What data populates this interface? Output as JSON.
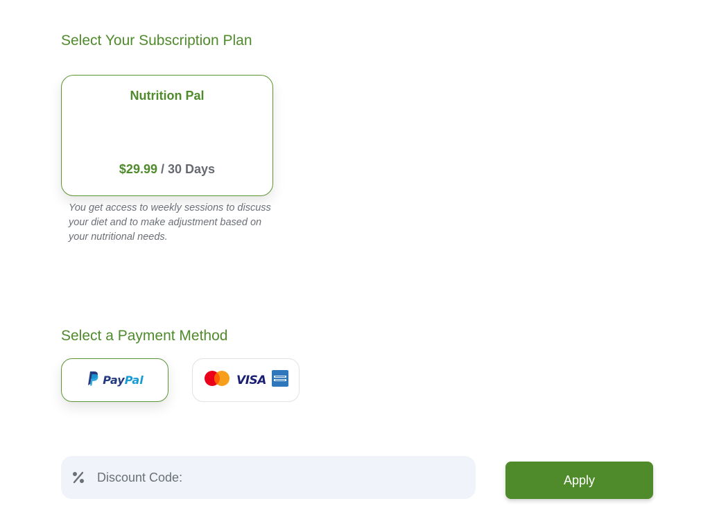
{
  "subscription": {
    "title": "Select Your Subscription Plan",
    "plan": {
      "name": "Nutrition Pal",
      "price": "$29.99",
      "separator": " / ",
      "period": "30 Days",
      "description": "You get access to weekly sessions to discuss your diet and to make adjustment based on your nutritional needs."
    }
  },
  "payment": {
    "title": "Select a Payment Method",
    "methods": [
      {
        "label_pay": "Pay",
        "label_pal": "Pal",
        "icon": "paypal-icon",
        "selected": true
      },
      {
        "visa_label": "VISA",
        "icons": [
          "mastercard-icon",
          "visa-icon",
          "amex-icon"
        ],
        "selected": false
      }
    ]
  },
  "discount": {
    "placeholder": "Discount Code:",
    "value": "",
    "icon": "percent-icon",
    "apply_label": "Apply"
  },
  "colors": {
    "accent": "#4f8a2b",
    "muted_text": "#6b6f76",
    "input_bg": "#f0f3fa"
  }
}
